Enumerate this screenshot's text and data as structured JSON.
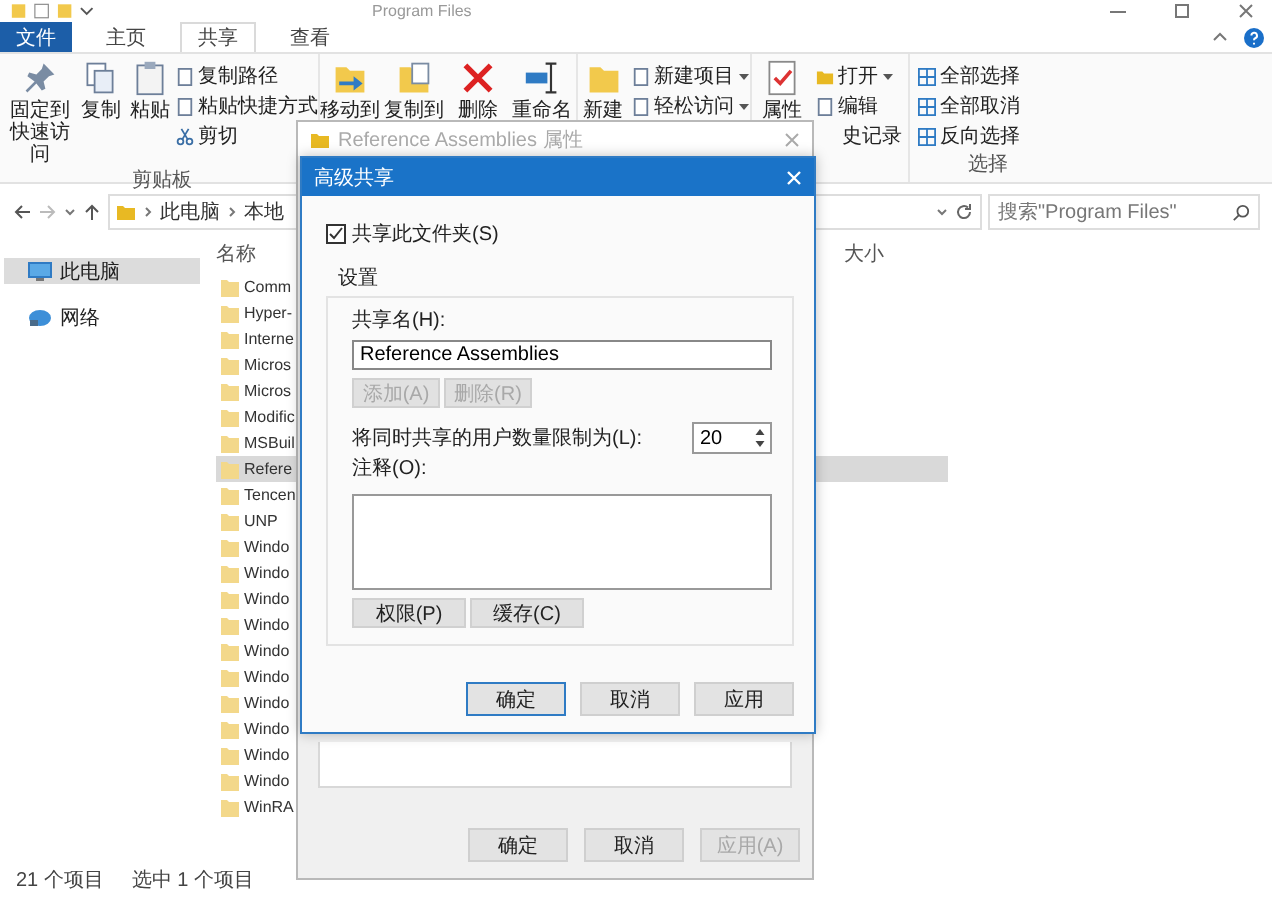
{
  "window": {
    "title": "Program Files"
  },
  "tabs": [
    {
      "label": "文件",
      "kind": "file",
      "selected": false
    },
    {
      "label": "主页",
      "kind": "tab",
      "selected": false
    },
    {
      "label": "共享",
      "kind": "tab",
      "selected": true
    },
    {
      "label": "查看",
      "kind": "tab",
      "selected": false
    }
  ],
  "ribbon": {
    "groups": [
      {
        "label": "剪贴板",
        "large": [
          {
            "label": "固定到快速访问"
          },
          {
            "label": "复制"
          },
          {
            "label": "粘贴"
          }
        ],
        "small": [
          {
            "label": "复制路径",
            "kind": "item"
          },
          {
            "label": "粘贴快捷方式",
            "kind": "item"
          },
          {
            "label": "剪切",
            "kind": "item"
          }
        ]
      },
      {
        "large": [
          {
            "label": "移动到"
          },
          {
            "label": "复制到"
          },
          {
            "label": "删除"
          },
          {
            "label": "重命名"
          }
        ]
      },
      {
        "large": [
          {
            "label": "新建"
          }
        ],
        "small": [
          {
            "label": "新建项目",
            "kind": "item",
            "dropdown": true
          },
          {
            "label": "轻松访问",
            "kind": "item",
            "dropdown": true
          }
        ]
      },
      {
        "large": [
          {
            "label": "属性"
          }
        ],
        "small": [
          {
            "label": "打开",
            "kind": "item",
            "dropdown": true
          },
          {
            "label": "编辑",
            "kind": "item"
          },
          {
            "label": "史记录",
            "kind": "partial"
          }
        ]
      },
      {
        "label": "选择",
        "small": [
          {
            "label": "全部选择",
            "kind": "item"
          },
          {
            "label": "全部取消",
            "kind": "item"
          },
          {
            "label": "反向选择",
            "kind": "item"
          }
        ]
      }
    ]
  },
  "address": {
    "crumbs": [
      "此电脑",
      "本地"
    ]
  },
  "search": {
    "placeholder": "搜索\"Program Files\""
  },
  "sidebar": {
    "items": [
      {
        "label": "此电脑",
        "kind": "pc",
        "selected": true
      },
      {
        "label": "网络",
        "kind": "network",
        "selected": false
      }
    ]
  },
  "file_list": {
    "columns": [
      "名称",
      "大小"
    ],
    "rows": [
      {
        "name": "Comm",
        "selected": false
      },
      {
        "name": "Hyper-",
        "selected": false
      },
      {
        "name": "Interne",
        "selected": false
      },
      {
        "name": "Micros",
        "selected": false
      },
      {
        "name": "Micros",
        "selected": false
      },
      {
        "name": "Modific",
        "selected": false
      },
      {
        "name": "MSBuil",
        "selected": false
      },
      {
        "name": "Refere",
        "selected": true
      },
      {
        "name": "Tencen",
        "selected": false
      },
      {
        "name": "UNP",
        "selected": false
      },
      {
        "name": "Windo",
        "selected": false
      },
      {
        "name": "Windo",
        "selected": false
      },
      {
        "name": "Windo",
        "selected": false
      },
      {
        "name": "Windo",
        "selected": false
      },
      {
        "name": "Windo",
        "selected": false
      },
      {
        "name": "Windo",
        "selected": false
      },
      {
        "name": "Windo",
        "selected": false
      },
      {
        "name": "Windo",
        "selected": false
      },
      {
        "name": "Windo",
        "selected": false
      },
      {
        "name": "Windo",
        "selected": false
      },
      {
        "name": "WinRA",
        "selected": false
      }
    ]
  },
  "status_bar": {
    "item_count": "21 个项目",
    "selection": "选中 1 个项目"
  },
  "properties_dialog": {
    "title": "Reference Assemblies 属性",
    "buttons": [
      {
        "label": "确定",
        "disabled": false
      },
      {
        "label": "取消",
        "disabled": false
      },
      {
        "label": "应用(A)",
        "disabled": true
      }
    ]
  },
  "advanced_sharing_dialog": {
    "title": "高级共享",
    "share_checkbox": {
      "label": "共享此文件夹(S)",
      "checked": true
    },
    "settings_label": "设置",
    "share_name": {
      "label": "共享名(H):",
      "value": "Reference Assemblies"
    },
    "name_buttons": [
      {
        "label": "添加(A)",
        "disabled": true
      },
      {
        "label": "删除(R)",
        "disabled": true
      }
    ],
    "user_limit": {
      "label": "将同时共享的用户数量限制为(L):",
      "value": "20"
    },
    "comment": {
      "label": "注释(O):"
    },
    "action_buttons": [
      {
        "label": "权限(P)",
        "disabled": false
      },
      {
        "label": "缓存(C)",
        "disabled": false
      }
    ],
    "buttons": [
      {
        "label": "确定",
        "focused": true
      },
      {
        "label": "取消",
        "focused": false
      },
      {
        "label": "应用",
        "focused": false
      }
    ]
  }
}
